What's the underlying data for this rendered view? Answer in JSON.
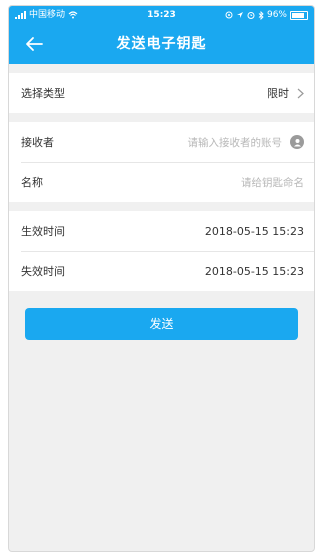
{
  "status_bar": {
    "carrier": "中国移动",
    "time": "15:23",
    "battery": "96%"
  },
  "navbar": {
    "title": "发送电子钥匙",
    "back_icon": "arrow-left-icon"
  },
  "form": {
    "type": {
      "label": "选择类型",
      "value": "限时"
    },
    "receiver": {
      "label": "接收者",
      "placeholder": "请输入接收者的账号"
    },
    "name": {
      "label": "名称",
      "placeholder": "请给钥匙命名"
    },
    "start_time": {
      "label": "生效时间",
      "value": "2018-05-15 15:23"
    },
    "end_time": {
      "label": "失效时间",
      "value": "2018-05-15 15:23"
    }
  },
  "submit_label": "发送",
  "colors": {
    "accent": "#1aa8f0",
    "background": "#f0f0f0"
  }
}
